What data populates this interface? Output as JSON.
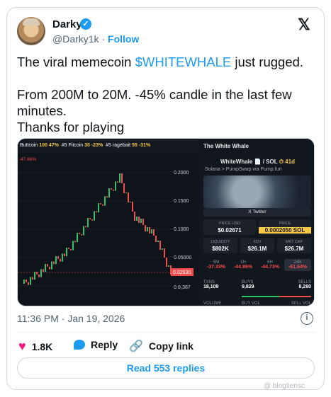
{
  "author": {
    "name": "Darky",
    "handle": "@Darky1k",
    "separator": "·",
    "follow_label": "Follow"
  },
  "tweet": {
    "line1_before": "The viral memecoin ",
    "cashtag": "$WHITEWHALE",
    "line1_after": " just rugged.",
    "line2": "From 200M to 20M. -45% candle in the last few minutes.",
    "line3": "Thanks for playing"
  },
  "media": {
    "ticker": [
      {
        "name": "Buttcoin",
        "val": "100 47%"
      },
      {
        "rank": "#5",
        "name": "Fitcoin",
        "val": "30 -23%"
      },
      {
        "rank": "#5",
        "name": "ragebait",
        "val": "55 -31%"
      }
    ],
    "chart_prices": [
      "0.2000",
      "0.1500",
      "0.1000",
      "0.05000",
      "0.02630",
      "0.0₁387"
    ],
    "chart_pct": "-47.66%",
    "token_title": "The White Whale",
    "token_symbol": "WhiteWhale 📄 / SOL",
    "token_badge": "⏱ 41d",
    "network": "Solana > PumpSwap via Pump.fun",
    "twitter_label": "X Twitter",
    "price_usd_label": "PRICE USD",
    "price_usd": "$0.02671",
    "price_label": "PRICE",
    "price_sol": "0.0002050 SOL",
    "liquidity_label": "LIQUIDITY",
    "liquidity": "$802K",
    "fdv_label": "FDV",
    "fdv": "$26.1M",
    "mcap_label": "MKT CAP",
    "mcap": "$26.7M",
    "changes": [
      {
        "l": "5M",
        "v": "-37.33%"
      },
      {
        "l": "1H",
        "v": "-44.86%"
      },
      {
        "l": "6H",
        "v": "-44.73%"
      },
      {
        "l": "24H",
        "v": "-61.64%"
      }
    ],
    "txns_label": "TXNS",
    "txns": "18,109",
    "buys_label": "BUYS",
    "buys": "9,829",
    "sells_label": "SELLS",
    "sells": "8,280",
    "volume_label": "VOLUME",
    "buy_vol_label": "BUY VOL",
    "sell_vol_label": "SELL VOL"
  },
  "meta": {
    "time": "11:36 PM · Jan 19, 2026",
    "info": "i"
  },
  "actions": {
    "likes": "1.8K",
    "reply": "Reply",
    "copy": "Copy link",
    "read_replies": "Read 553 replies"
  },
  "watermark": "@ blogtiensc",
  "colors": {
    "accent": "#1d9bf0",
    "like": "#f91880",
    "down": "#f44d4d"
  }
}
